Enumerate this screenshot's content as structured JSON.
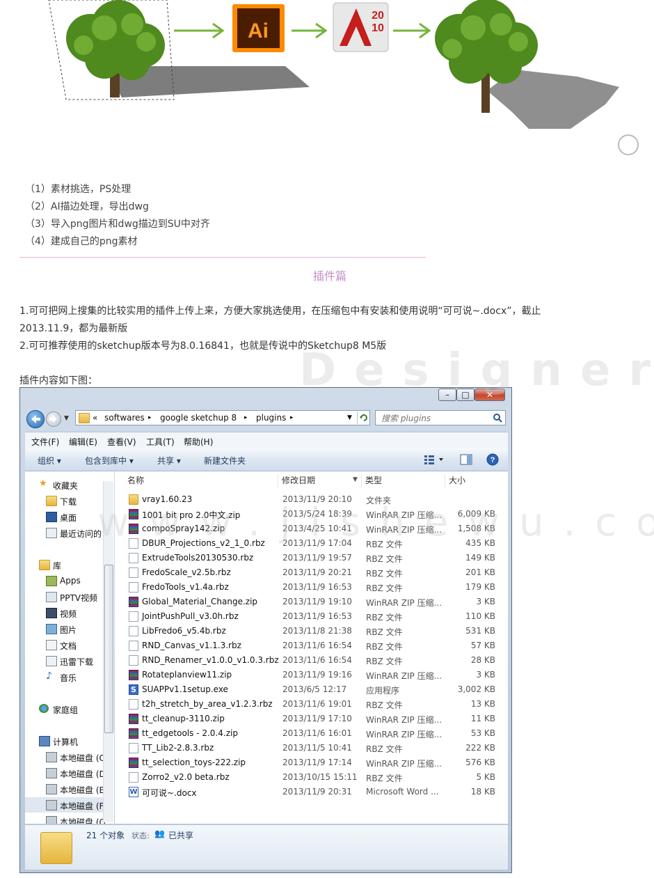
{
  "article": {
    "steps": [
      "（1）素材挑选，PS处理",
      "（2）AI描边处理，导出dwg",
      "（3）导入png图片和dwg描边到SU中对齐",
      "（4）建成自己的png素材"
    ],
    "section_title": "插件篇",
    "para1_line1": "1.可可把网上搜集的比较实用的插件上传上来，方便大家挑选使用，在压缩包中有安装和使用说明“可可说~.docx”，截止",
    "para1_line2": "2013.11.9，都为最新版",
    "para2": "2.可可推荐使用的sketchup版本号为8.0.16841，也就是传说中的Sketchup8 M5版",
    "caption": "插件内容如下图："
  },
  "figure": {
    "ai_label": "Ai",
    "cad_year_top": "20",
    "cad_year_bottom": "10"
  },
  "window": {
    "caption_buttons": {
      "minimize": "–",
      "maximize": "□",
      "close": "✕"
    },
    "address": {
      "chevron": "«",
      "segments": [
        "softwares",
        "google sketchup 8",
        "plugins"
      ],
      "sep": "▸"
    },
    "search_placeholder": "搜索 plugins",
    "menu": [
      "文件(F)",
      "编辑(E)",
      "查看(V)",
      "工具(T)",
      "帮助(H)"
    ],
    "toolbar": [
      "组织 ▾",
      "包含到库中 ▾",
      "共享 ▾",
      "新建文件夹"
    ],
    "sidebar": {
      "favorites": "收藏夹",
      "fav_items": [
        "下载",
        "桌面",
        "最近访问的"
      ],
      "libraries": "库",
      "lib_items": [
        "Apps",
        "PPTV视频",
        "视频",
        "图片",
        "文档",
        "迅雷下载",
        "音乐"
      ],
      "homegroup": "家庭组",
      "computer": "计算机",
      "drives": [
        "本地磁盘 (C",
        "本地磁盘 (D",
        "本地磁盘 (E",
        "本地磁盘 (F",
        "本地磁盘 (G"
      ]
    },
    "columns": {
      "name": "名称",
      "date": "修改日期",
      "type": "类型",
      "size": "大小"
    },
    "files": [
      {
        "name": "vray1.60.23",
        "date": "2013/11/9 20:10",
        "type": "文件夹",
        "size": "",
        "icon": "folder"
      },
      {
        "name": "1001 bit pro 2.0中文.zip",
        "date": "2013/5/24 18:39",
        "type": "WinRAR ZIP 压缩...",
        "size": "6,009 KB",
        "icon": "rar"
      },
      {
        "name": "compoSpray142.zip",
        "date": "2013/4/25 10:41",
        "type": "WinRAR ZIP 压缩...",
        "size": "1,508 KB",
        "icon": "rar"
      },
      {
        "name": "DBUR_Projections_v2_1_0.rbz",
        "date": "2013/11/9 17:04",
        "type": "RBZ 文件",
        "size": "435 KB",
        "icon": "doc"
      },
      {
        "name": "ExtrudeTools20130530.rbz",
        "date": "2013/11/9 19:57",
        "type": "RBZ 文件",
        "size": "149 KB",
        "icon": "doc"
      },
      {
        "name": "FredoScale_v2.5b.rbz",
        "date": "2013/11/9 20:21",
        "type": "RBZ 文件",
        "size": "201 KB",
        "icon": "doc"
      },
      {
        "name": "FredoTools_v1.4a.rbz",
        "date": "2013/11/9 16:53",
        "type": "RBZ 文件",
        "size": "179 KB",
        "icon": "doc"
      },
      {
        "name": "Global_Material_Change.zip",
        "date": "2013/11/9 19:10",
        "type": "WinRAR ZIP 压缩...",
        "size": "3 KB",
        "icon": "rar"
      },
      {
        "name": "JointPushPull_v3.0h.rbz",
        "date": "2013/11/9 16:53",
        "type": "RBZ 文件",
        "size": "110 KB",
        "icon": "doc"
      },
      {
        "name": "LibFredo6_v5.4b.rbz",
        "date": "2013/11/8 21:38",
        "type": "RBZ 文件",
        "size": "531 KB",
        "icon": "doc"
      },
      {
        "name": "RND_Canvas_v1.1.3.rbz",
        "date": "2013/11/6 16:54",
        "type": "RBZ 文件",
        "size": "57 KB",
        "icon": "doc"
      },
      {
        "name": "RND_Renamer_v1.0.0_v1.0.3.rbz",
        "date": "2013/11/6 16:54",
        "type": "RBZ 文件",
        "size": "28 KB",
        "icon": "doc"
      },
      {
        "name": "Rotateplanview11.zip",
        "date": "2013/11/9 19:16",
        "type": "WinRAR ZIP 压缩...",
        "size": "3 KB",
        "icon": "rar"
      },
      {
        "name": "SUAPPv1.1setup.exe",
        "date": "2013/6/5 12:17",
        "type": "应用程序",
        "size": "3,002 KB",
        "icon": "exe"
      },
      {
        "name": "t2h_stretch_by_area_v1.2.3.rbz",
        "date": "2013/11/6 19:01",
        "type": "RBZ 文件",
        "size": "13 KB",
        "icon": "doc"
      },
      {
        "name": "tt_cleanup-3110.zip",
        "date": "2013/11/9 17:10",
        "type": "WinRAR ZIP 压缩...",
        "size": "11 KB",
        "icon": "rar"
      },
      {
        "name": "tt_edgetools - 2.0.4.zip",
        "date": "2013/11/6 16:01",
        "type": "WinRAR ZIP 压缩...",
        "size": "53 KB",
        "icon": "rar"
      },
      {
        "name": "TT_Lib2-2.8.3.rbz",
        "date": "2013/11/5 10:41",
        "type": "RBZ 文件",
        "size": "222 KB",
        "icon": "doc"
      },
      {
        "name": "tt_selection_toys-222.zip",
        "date": "2013/11/9 17:14",
        "type": "WinRAR ZIP 压缩...",
        "size": "576 KB",
        "icon": "rar"
      },
      {
        "name": "Zorro2_v2.0 beta.rbz",
        "date": "2013/10/15 15:11",
        "type": "RBZ 文件",
        "size": "5 KB",
        "icon": "doc"
      },
      {
        "name": "可可说~.docx",
        "date": "2013/11/9 20:31",
        "type": "Microsoft Word ...",
        "size": "18 KB",
        "icon": "word"
      }
    ],
    "status": {
      "count": "21 个对象",
      "state_label": "状态:",
      "state_value": "已共享"
    }
  },
  "watermark": {
    "word": "Designer",
    "cn": "",
    "url": "www.jishewu.com"
  },
  "colors": {
    "divider": "#e4b6dc",
    "section_title": "#c58bc7",
    "arrow": "#76b43a",
    "ai_bg": "#ff8a00"
  }
}
